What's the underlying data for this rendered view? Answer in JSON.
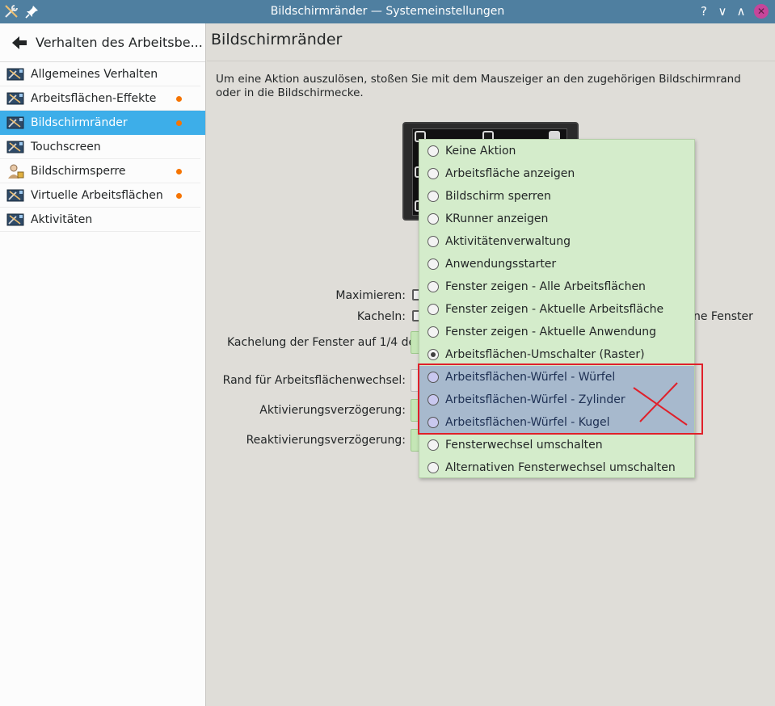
{
  "window": {
    "title": "Bildschirmränder — Systemeinstellungen",
    "buttons": {
      "help": "?",
      "minimize": "∨",
      "maximize": "∧",
      "close": "✕"
    }
  },
  "sidebar": {
    "header": "Verhalten des Arbeitsbe...",
    "items": [
      {
        "label": "Allgemeines Verhalten",
        "icon": "desktop-settings-icon",
        "modified": false,
        "selected": false
      },
      {
        "label": "Arbeitsflächen-Effekte",
        "icon": "desktop-effects-icon",
        "modified": true,
        "selected": false
      },
      {
        "label": "Bildschirmränder",
        "icon": "screen-edges-icon",
        "modified": true,
        "selected": true
      },
      {
        "label": "Touchscreen",
        "icon": "touchscreen-icon",
        "modified": false,
        "selected": false
      },
      {
        "label": "Bildschirmsperre",
        "icon": "user-lock-icon",
        "modified": true,
        "selected": false
      },
      {
        "label": "Virtuelle Arbeitsflächen",
        "icon": "virtual-desktops-icon",
        "modified": true,
        "selected": false
      },
      {
        "label": "Aktivitäten",
        "icon": "activities-icon",
        "modified": false,
        "selected": false
      }
    ]
  },
  "main": {
    "title": "Bildschirmränder",
    "description": "Um eine Aktion auszulösen, stoßen Sie mit dem Mauszeiger an den zugehörigen Bildschirmrand oder in die Bildschirmecke.",
    "form": {
      "maximize_label": "Maximieren:",
      "tile_label": "Kacheln:",
      "quarter_tiling_label": "Kachelung der Fenster auf 1/4 de",
      "desktop_switch_label": "Rand für Arbeitsflächenwechsel:",
      "activation_delay_label": "Aktivierungsverzögerung:",
      "reactivation_delay_label": "Reaktivierungsverzögerung:",
      "right_fragment": "ne Fenster"
    }
  },
  "popup": {
    "items": [
      {
        "label": "Keine Aktion",
        "checked": false,
        "highlighted": false
      },
      {
        "label": "Arbeitsfläche anzeigen",
        "checked": false,
        "highlighted": false
      },
      {
        "label": "Bildschirm sperren",
        "checked": false,
        "highlighted": false
      },
      {
        "label": "KRunner anzeigen",
        "checked": false,
        "highlighted": false
      },
      {
        "label": "Aktivitätenverwaltung",
        "checked": false,
        "highlighted": false
      },
      {
        "label": "Anwendungsstarter",
        "checked": false,
        "highlighted": false
      },
      {
        "label": "Fenster zeigen - Alle Arbeitsflächen",
        "checked": false,
        "highlighted": false
      },
      {
        "label": "Fenster zeigen - Aktuelle Arbeitsfläche",
        "checked": false,
        "highlighted": false
      },
      {
        "label": "Fenster zeigen - Aktuelle Anwendung",
        "checked": false,
        "highlighted": false
      },
      {
        "label": "Arbeitsflächen-Umschalter (Raster)",
        "checked": true,
        "highlighted": false
      },
      {
        "label": "Arbeitsflächen-Würfel - Würfel",
        "checked": false,
        "highlighted": true
      },
      {
        "label": "Arbeitsflächen-Würfel - Zylinder",
        "checked": false,
        "highlighted": true
      },
      {
        "label": "Arbeitsflächen-Würfel - Kugel",
        "checked": false,
        "highlighted": true
      },
      {
        "label": "Fensterwechsel umschalten",
        "checked": false,
        "highlighted": false
      },
      {
        "label": "Alternativen Fensterwechsel umschalten",
        "checked": false,
        "highlighted": false
      }
    ]
  },
  "colors": {
    "titlebar": "#4f7fa0",
    "selection": "#3daee9",
    "popup_bg": "#d4eccb",
    "popup_highlight": "#a7b9cd",
    "annotation_red": "#e0202a",
    "modified_dot": "#f67400"
  }
}
